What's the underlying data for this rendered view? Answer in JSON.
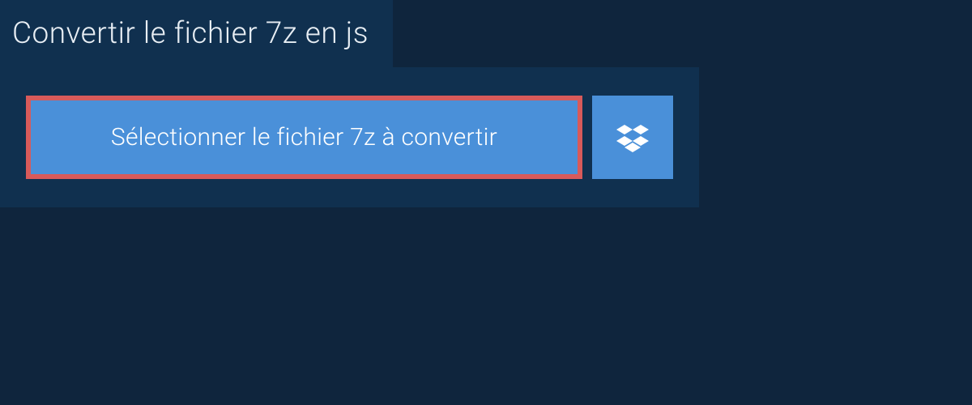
{
  "header": {
    "title": "Convertir le fichier 7z en js"
  },
  "upload": {
    "select_button_label": "Sélectionner le fichier 7z à convertir"
  },
  "colors": {
    "background": "#0f253d",
    "panel": "#10304f",
    "button": "#4a90d9",
    "highlight_border": "#d85a5a",
    "text_light": "#e8eef4"
  }
}
